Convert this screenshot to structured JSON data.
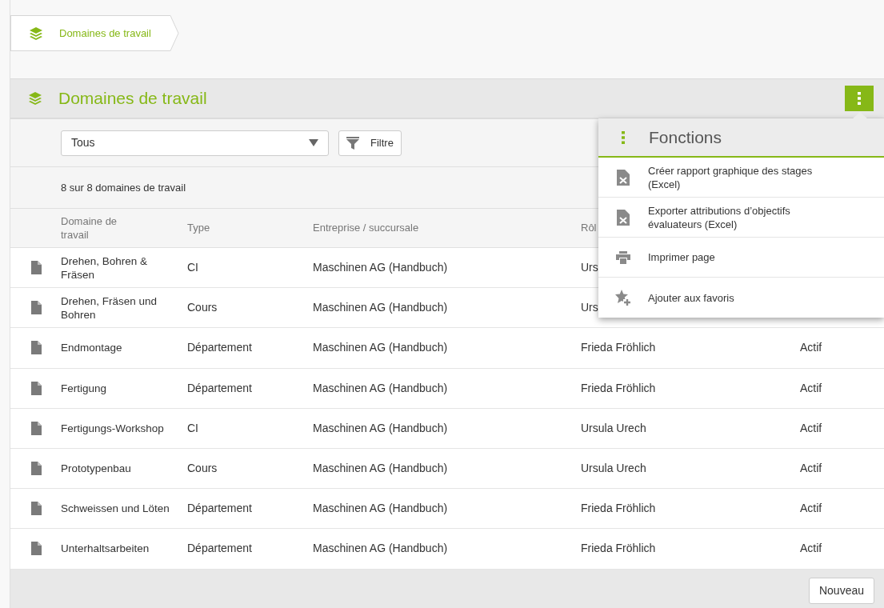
{
  "breadcrumb": {
    "label": "Domaines de travail"
  },
  "panel": {
    "title": "Domaines de travail"
  },
  "filter": {
    "value": "Tous",
    "button": "Filtre"
  },
  "count": "8 sur 8 domaines de travail",
  "table": {
    "columns": [
      "Domaine de travail",
      "Type",
      "Entreprise / succursale",
      "Rôl"
    ],
    "rows": [
      {
        "name": "Drehen, Bohren & Fräsen",
        "type": "CI",
        "company": "Maschinen AG (Handbuch)",
        "role": "Urs"
      },
      {
        "name": "Drehen, Fräsen und Bohren",
        "type": "Cours",
        "company": "Maschinen AG (Handbuch)",
        "role": "Urs"
      },
      {
        "name": "Endmontage",
        "type": "Département",
        "company": "Maschinen AG (Handbuch)",
        "role": "Frieda Fröhlich",
        "status": "Actif"
      },
      {
        "name": "Fertigung",
        "type": "Département",
        "company": "Maschinen AG (Handbuch)",
        "role": "Frieda Fröhlich",
        "status": "Actif"
      },
      {
        "name": "Fertigungs-Workshop",
        "type": "CI",
        "company": "Maschinen AG (Handbuch)",
        "role": "Ursula Urech",
        "status": "Actif"
      },
      {
        "name": "Prototypenbau",
        "type": "Cours",
        "company": "Maschinen AG (Handbuch)",
        "role": "Ursula Urech",
        "status": "Actif"
      },
      {
        "name": "Schweissen und Löten",
        "type": "Département",
        "company": "Maschinen AG (Handbuch)",
        "role": "Frieda Fröhlich",
        "status": "Actif"
      },
      {
        "name": "Unterhaltsarbeiten",
        "type": "Département",
        "company": "Maschinen AG (Handbuch)",
        "role": "Frieda Fröhlich",
        "status": "Actif"
      }
    ]
  },
  "footer": {
    "button": "Nouveau"
  },
  "menu": {
    "title": "Fonctions",
    "items": [
      {
        "kind": "excel",
        "label": "Créer rapport graphique des stages (Excel)"
      },
      {
        "kind": "excel",
        "label": "Exporter attributions d’objectifs évaluateurs (Excel)"
      },
      {
        "kind": "print",
        "label": "Imprimer page"
      },
      {
        "kind": "favorite",
        "label": "Ajouter aux favoris"
      }
    ]
  }
}
